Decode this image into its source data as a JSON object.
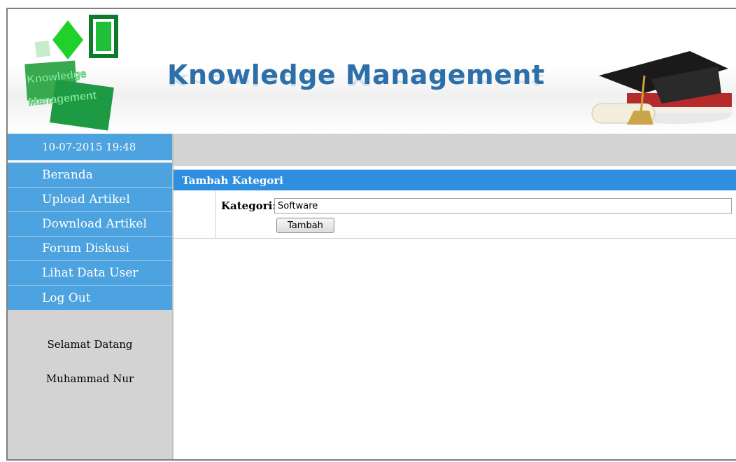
{
  "header": {
    "logo_text_line1": "Knowledge",
    "logo_text_line2": "Management",
    "title": "Knowledge Management",
    "graduation_icon": "graduation-cap-icon"
  },
  "sidebar": {
    "datetime": "10-07-2015 19:48",
    "menu": [
      {
        "label": "Beranda"
      },
      {
        "label": "Upload Artikel"
      },
      {
        "label": "Download Artikel"
      },
      {
        "label": "Forum Diskusi"
      },
      {
        "label": "Lihat Data User"
      },
      {
        "label": "Log Out"
      }
    ],
    "welcome": "Selamat Datang",
    "username": "Muhammad Nur"
  },
  "form": {
    "heading": "Tambah Kategori",
    "label": "Kategori:",
    "value": "Software",
    "button": "Tambah"
  },
  "colors": {
    "menu_blue": "#4da3df",
    "panel_blue": "#2e8fe0",
    "title_blue": "#2d6fa8",
    "logo_green": "#1f9e3a"
  }
}
